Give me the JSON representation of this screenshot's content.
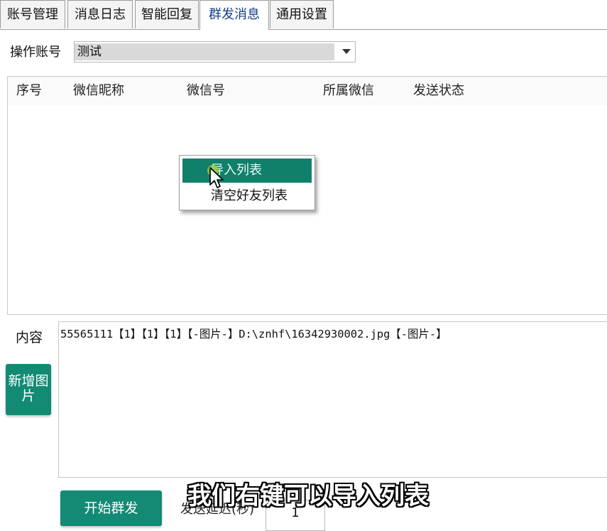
{
  "tabs": [
    {
      "label": "账号管理",
      "active": false
    },
    {
      "label": "消息日志",
      "active": false
    },
    {
      "label": "智能回复",
      "active": false
    },
    {
      "label": "群发消息",
      "active": true
    },
    {
      "label": "通用设置",
      "active": false
    }
  ],
  "account": {
    "label": "操作账号",
    "selected": "测试"
  },
  "table": {
    "columns": [
      "序号",
      "微信昵称",
      "微信号",
      "所属微信",
      "发送状态"
    ]
  },
  "context_menu": {
    "items": [
      "导入列表",
      "清空好友列表"
    ]
  },
  "content": {
    "label": "内容",
    "text": "55565111【1】【1】【1】【-图片-】D:\\znhf\\16342930002.jpg【-图片-】"
  },
  "buttons": {
    "add_image": "新增图片",
    "start": "开始群发"
  },
  "delay": {
    "label": "发送延迟(秒)",
    "value": "1"
  },
  "subtitle": "我们右键可以导入列表",
  "colors": {
    "accent": "#128a74",
    "active_tab_text": "#123c8a"
  }
}
